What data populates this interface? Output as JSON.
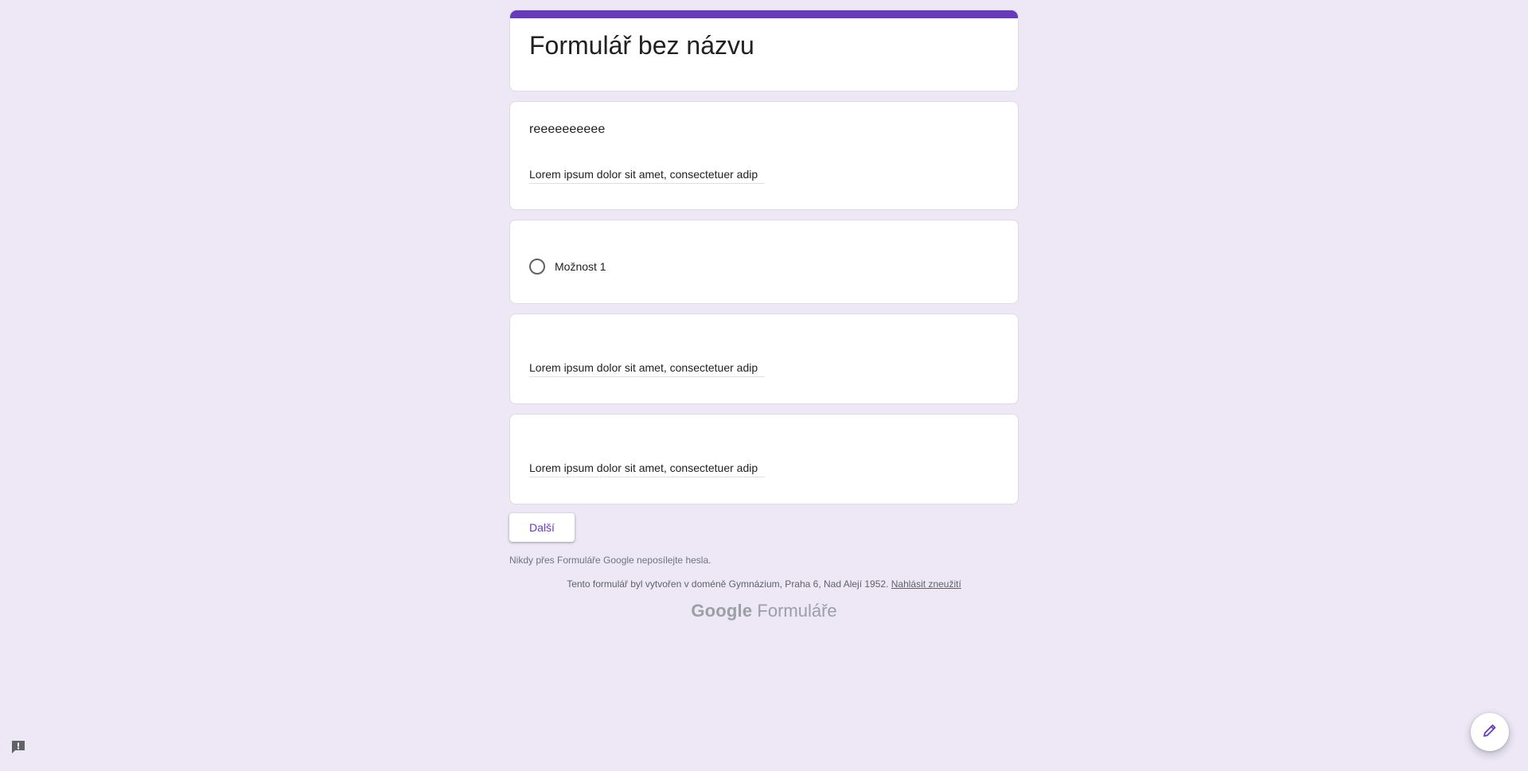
{
  "form": {
    "title": "Formulář bez názvu",
    "accent_color": "#673ab7",
    "background_color": "#ede7f6"
  },
  "questions": [
    {
      "title": "reeeeeeeeee",
      "answer_value": "Lorem ipsum dolor sit amet, consectetuer adip"
    },
    {
      "option_label": "Možnost 1"
    },
    {
      "answer_value": "Lorem ipsum dolor sit amet, consectetuer adip"
    },
    {
      "answer_value": "Lorem ipsum dolor sit amet, consectetuer adip"
    }
  ],
  "actions": {
    "next_label": "Další"
  },
  "footer": {
    "password_note": "Nikdy přes Formuláře Google neposílejte hesla.",
    "domain_note": "Tento formulář byl vytvořen v doméně Gymnázium, Praha 6, Nad Alejí 1952.",
    "report_link": "Nahlásit zneužití",
    "brand_google": "Google",
    "brand_forms": "Formuláře"
  },
  "icons": {
    "feedback": "feedback-icon",
    "edit": "pencil-icon"
  }
}
